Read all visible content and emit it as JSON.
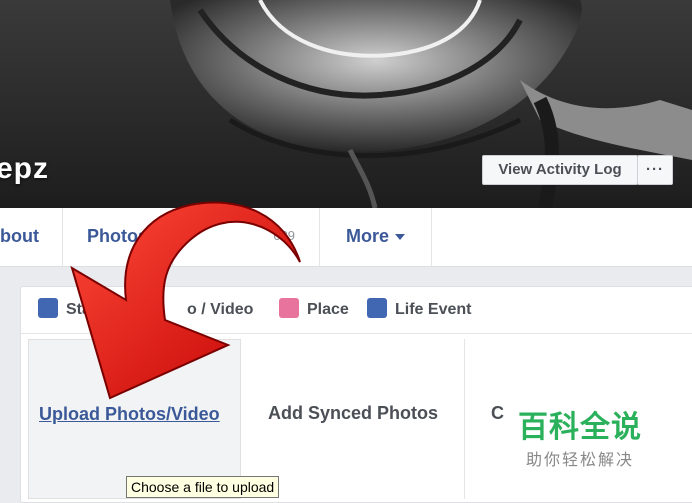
{
  "profile": {
    "name_fragment": "epz"
  },
  "header": {
    "activity_log_label": "View Activity Log",
    "more_label": "···"
  },
  "nav": {
    "about": "bout",
    "photos": "Photos",
    "friends_count": "689",
    "more": "More"
  },
  "composer": {
    "tabs": {
      "status": "Sta",
      "photo_video": "o / Video",
      "place": "Place",
      "life_event": "Life Event"
    },
    "options": {
      "upload": "Upload Photos/Video",
      "synced": "Add Synced Photos",
      "third": "C"
    }
  },
  "tooltip": "Choose a file to upload",
  "watermark": {
    "title": "百科全说",
    "subtitle": "助你轻松解决"
  },
  "colors": {
    "link": "#3b5998",
    "arrow": "#e01010",
    "watermark": "#2bb15b"
  }
}
